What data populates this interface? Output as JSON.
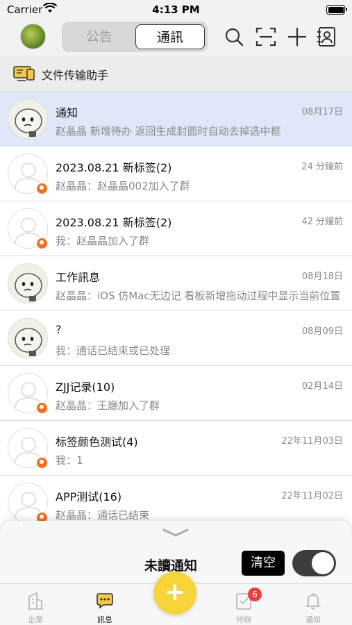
{
  "status_bar": {
    "carrier": "Carrier",
    "time": "4:13 PM"
  },
  "nav": {
    "segments": [
      "公告",
      "通訊"
    ],
    "active_segment": "通訊",
    "icons": [
      "search-icon",
      "scan-icon",
      "plus-icon",
      "contacts-icon"
    ]
  },
  "file_helper": {
    "label": "文件传输助手",
    "icon": "monitor-icon"
  },
  "conversations": [
    {
      "title": "通知",
      "time": "08月17日",
      "preview": "赵晶晶 新增待办 返回生成封面时自动去掉选中框",
      "avatar": "emoji",
      "group": false,
      "selected": true
    },
    {
      "title": "2023.08.21 新标签(2)",
      "time": "24 分鐘前",
      "preview": "赵晶晶：赵晶晶002加入了群",
      "avatar": "person",
      "group": true,
      "selected": false
    },
    {
      "title": "2023.08.21 新标签(2)",
      "time": "42 分鐘前",
      "preview": "我：赵晶晶加入了群",
      "avatar": "person",
      "group": true,
      "selected": false
    },
    {
      "title": "工作訊息",
      "time": "08月18日",
      "preview": "赵晶晶：iOS 仿Mac无边记 看板新增拖动过程中显示当前位置",
      "avatar": "emoji",
      "group": false,
      "selected": false
    },
    {
      "title": "?",
      "time": "08月09日",
      "preview": "我：通话已结束或已处理",
      "avatar": "emoji",
      "group": false,
      "selected": false
    },
    {
      "title": "ZJJ记录(10)",
      "time": "02月14日",
      "preview": "赵晶晶：王廳加入了群",
      "avatar": "person",
      "group": true,
      "selected": false
    },
    {
      "title": "标签颜色测试(4)",
      "time": "22年11月03日",
      "preview": "我：1",
      "avatar": "person",
      "group": true,
      "selected": false
    },
    {
      "title": "APP测试(16)",
      "time": "22年11月02日",
      "preview": "赵晶晶：通话已结束",
      "avatar": "person",
      "group": true,
      "selected": false
    }
  ],
  "sheet": {
    "title": "未讀通知",
    "clear_label": "清空",
    "toggle_on": true
  },
  "tabbar": {
    "tabs": [
      {
        "label": "企業",
        "icon": "building-icon",
        "active": false
      },
      {
        "label": "訊息",
        "icon": "chat-icon",
        "active": true
      },
      {
        "label": "待辦",
        "icon": "checklist-icon",
        "active": false,
        "badge": "6"
      },
      {
        "label": "通知",
        "icon": "bell-icon",
        "active": false
      }
    ],
    "center": "+"
  },
  "colors": {
    "accent_yellow": "#f6d43a",
    "selected_row": "#dfe7f8",
    "badge_red": "#e74040",
    "group_badge": "#f07020"
  }
}
